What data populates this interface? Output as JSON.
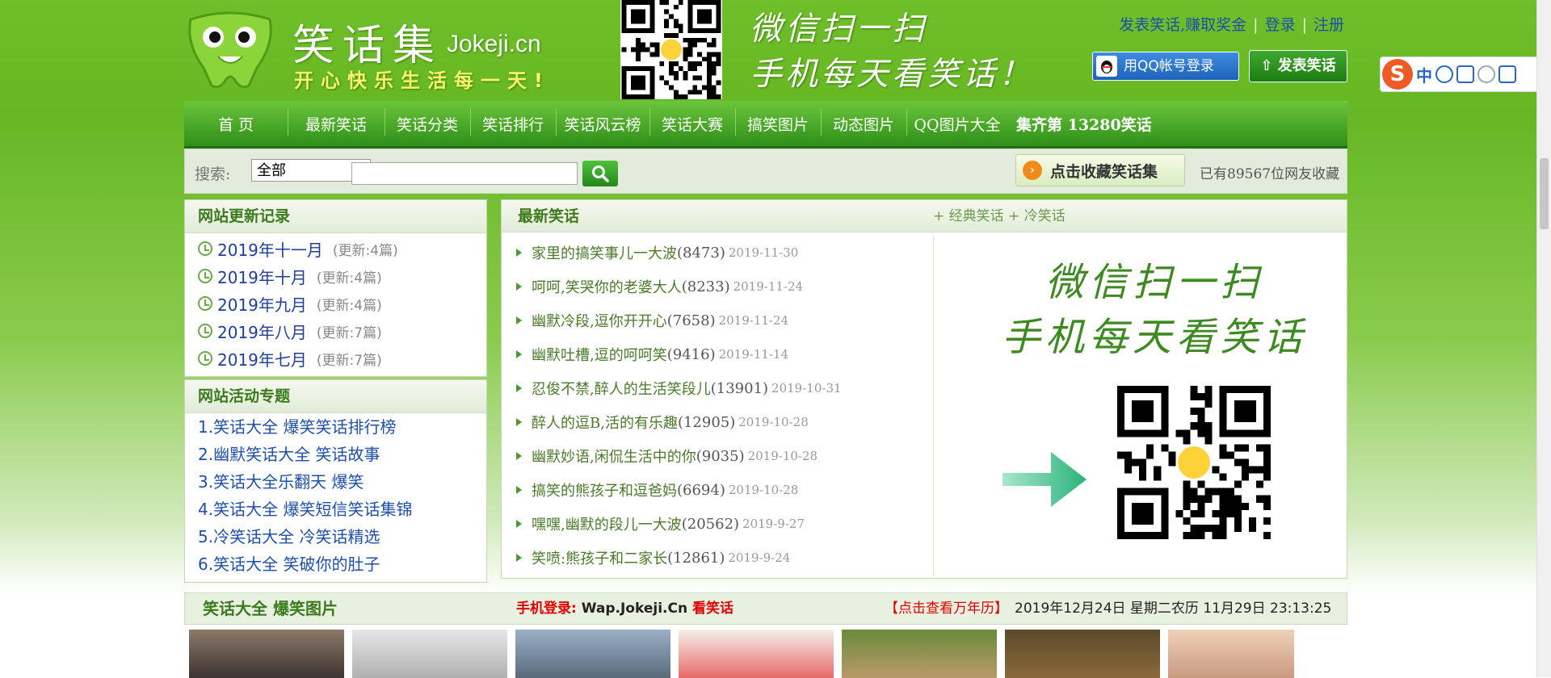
{
  "site": {
    "title": "笑话集",
    "domain": "Jokeji.cn",
    "slogan": "开心快乐生活每一天!",
    "header_scan_line1": "微信扫一扫",
    "header_scan_line2": "手机每天看笑话！"
  },
  "top_links": {
    "post_earn": "发表笑话,赚取奖金",
    "login": "登录",
    "register": "注册",
    "qq_login": "用QQ帐号登录",
    "post_joke": "发表笑话"
  },
  "nav": {
    "items": [
      "首 页",
      "最新笑话",
      "笑话分类",
      "笑话排行",
      "笑话风云榜",
      "笑话大赛",
      "搞笑图片",
      "动态图片",
      "QQ图片大全"
    ],
    "total": "集齐第 13280笑话"
  },
  "search": {
    "label": "搜索:",
    "category": "全部",
    "input_value": "",
    "favorite_btn": "点击收藏笑话集",
    "favorite_count": "已有89567位网友收藏"
  },
  "update_log": {
    "title": "网站更新记录",
    "items": [
      {
        "month": "2019年十一月",
        "count": "(更新:4篇)"
      },
      {
        "month": "2019年十月",
        "count": "(更新:4篇)"
      },
      {
        "month": "2019年九月",
        "count": "(更新:4篇)"
      },
      {
        "month": "2019年八月",
        "count": "(更新:7篇)"
      },
      {
        "month": "2019年七月",
        "count": "(更新:7篇)"
      }
    ]
  },
  "activities": {
    "title": "网站活动专题",
    "items": [
      "1.笑话大全 爆笑笑话排行榜",
      "2.幽默笑话大全 笑话故事",
      "3.笑话大全乐翻天 爆笑",
      "4.笑话大全 爆笑短信笑话集锦",
      "5.冷笑话大全 冷笑话精选",
      "6.笑话大全 笑破你的肚子"
    ]
  },
  "latest": {
    "title": "最新笑话",
    "more": "+ 经典笑话 + 冷笑话",
    "items": [
      {
        "title": "家里的搞笑事儿一大波",
        "count": "(8473)",
        "date": "2019-11-30"
      },
      {
        "title": "呵呵,笑哭你的老婆大人",
        "count": "(8233)",
        "date": "2019-11-24"
      },
      {
        "title": "幽默冷段,逗你开开心",
        "count": "(7658)",
        "date": "2019-11-24"
      },
      {
        "title": "幽默吐槽,逗的呵呵笑",
        "count": "(9416)",
        "date": "2019-11-14"
      },
      {
        "title": "忍俊不禁,醉人的生活笑段儿",
        "count": "(13901)",
        "date": "2019-10-31"
      },
      {
        "title": "醉人的逗B,活的有乐趣",
        "count": "(12905)",
        "date": "2019-10-28"
      },
      {
        "title": "幽默妙语,闲侃生活中的你",
        "count": "(9035)",
        "date": "2019-10-28"
      },
      {
        "title": "搞笑的熊孩子和逗爸妈",
        "count": "(6694)",
        "date": "2019-10-28"
      },
      {
        "title": "嘿嘿,幽默的段儿一大波",
        "count": "(20562)",
        "date": "2019-9-27"
      },
      {
        "title": "笑喷:熊孩子和二家长",
        "count": "(12861)",
        "date": "2019-9-24"
      }
    ],
    "promo_line1": "微信扫一扫",
    "promo_line2": "手机每天看笑话"
  },
  "bottom_bar": {
    "title": "笑话大全 爆笑图片",
    "mobile_label": "手机登录:",
    "mobile_site": "Wap.Jokeji.Cn",
    "mobile_suffix": "看笑话",
    "calendar_link": "【点击查看万年历】",
    "datetime": "2019年12月24日 星期二农历 11月29日 23:13:25"
  },
  "ime": {
    "logo": "S",
    "mode": "中"
  },
  "colors": {
    "brand_green": "#66b723",
    "nav_green": "#2e8f19",
    "link_blue": "#1f4fa8",
    "alert_red": "#e00000"
  }
}
